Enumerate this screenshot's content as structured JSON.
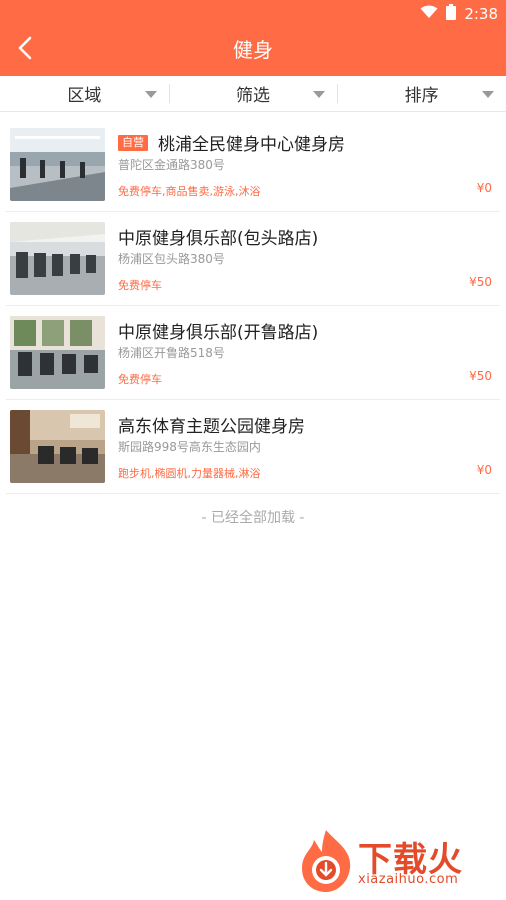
{
  "status_bar": {
    "time": "2:38",
    "wifi_icon": "wifi-icon",
    "battery_icon": "battery-icon"
  },
  "header": {
    "back_icon": "chevron-left-icon",
    "title": "健身"
  },
  "filters": [
    {
      "label": "区域",
      "icon": "caret-down-icon"
    },
    {
      "label": "筛选",
      "icon": "caret-down-icon"
    },
    {
      "label": "排序",
      "icon": "caret-down-icon"
    }
  ],
  "venues": [
    {
      "badge": "自营",
      "title": "桃浦全民健身中心健身房",
      "address": "普陀区金通路380号",
      "tags": "免费停车,商品售卖,游泳,沐浴",
      "price": "¥0"
    },
    {
      "badge": "",
      "title": "中原健身俱乐部(包头路店)",
      "address": "杨浦区包头路380号",
      "tags": "免费停车",
      "price": "¥50"
    },
    {
      "badge": "",
      "title": "中原健身俱乐部(开鲁路店)",
      "address": "杨浦区开鲁路518号",
      "tags": "免费停车",
      "price": "¥50"
    },
    {
      "badge": "",
      "title": "高东体育主题公园健身房",
      "address": "斯园路998号高东生态园内",
      "tags": "跑步机,椭圆机,力量器械,淋浴",
      "price": "¥0"
    }
  ],
  "footer": {
    "loaded_text": "- 已经全部加载 -"
  },
  "watermark": {
    "text": "下载火",
    "sub": "xiazaihuo.com"
  },
  "colors": {
    "accent": "#ff6b45",
    "tag": "#ff6b45",
    "muted": "#999999"
  }
}
